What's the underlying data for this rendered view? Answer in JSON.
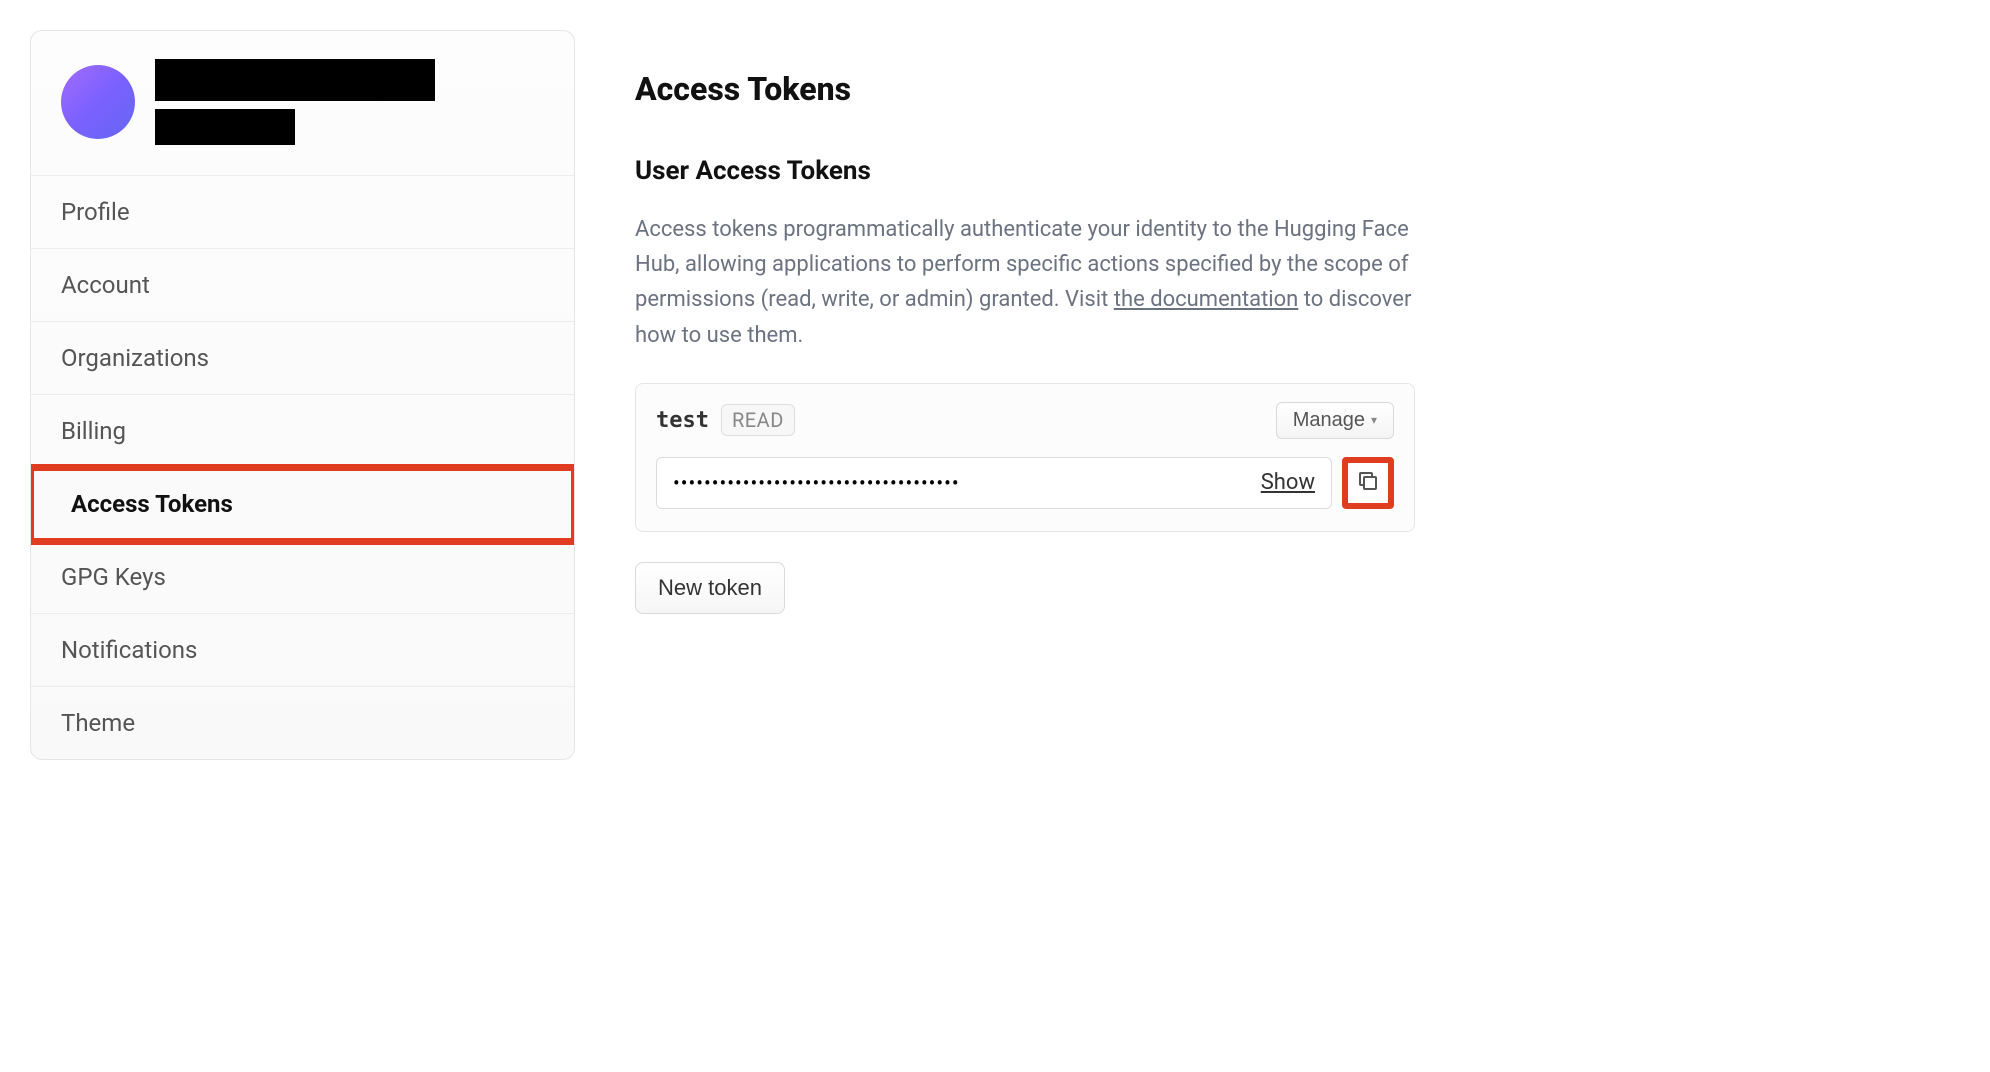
{
  "sidebar": {
    "nav": [
      {
        "label": "Profile",
        "active": false
      },
      {
        "label": "Account",
        "active": false
      },
      {
        "label": "Organizations",
        "active": false
      },
      {
        "label": "Billing",
        "active": false
      },
      {
        "label": "Access Tokens",
        "active": true
      },
      {
        "label": "GPG Keys",
        "active": false
      },
      {
        "label": "Notifications",
        "active": false
      },
      {
        "label": "Theme",
        "active": false
      }
    ]
  },
  "main": {
    "page_title": "Access Tokens",
    "section_title": "User Access Tokens",
    "description_pre": "Access tokens programmatically authenticate your identity to the Hugging Face Hub, allowing applications to perform specific actions specified by the scope of permissions (read, write, or admin) granted. Visit ",
    "description_link": "the documentation",
    "description_post": " to discover how to use them.",
    "token": {
      "name": "test",
      "scope": "READ",
      "manage_label": "Manage",
      "masked_value": "•••••••••••••••••••••••••••••••••••••",
      "show_label": "Show"
    },
    "new_token_label": "New token"
  }
}
